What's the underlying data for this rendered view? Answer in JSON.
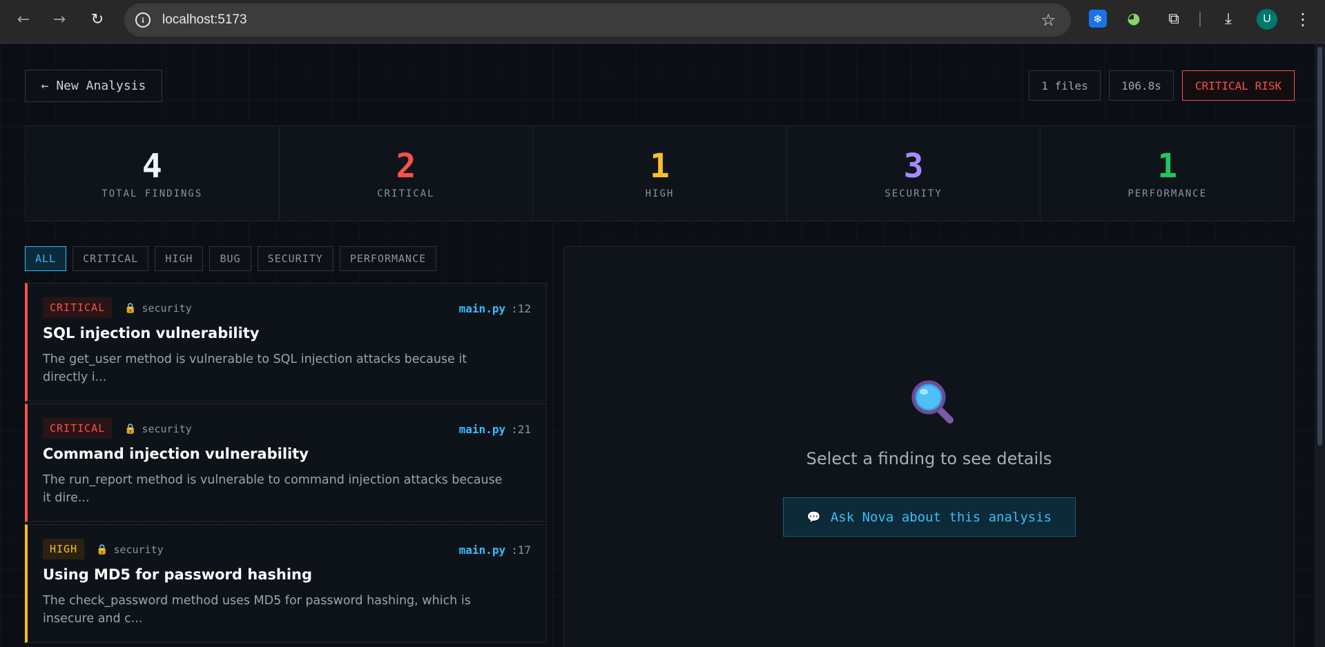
{
  "browser": {
    "url": "localhost:5173",
    "avatar_letter": "U",
    "icons": {
      "back": "back-arrow-icon",
      "forward": "forward-arrow-icon",
      "reload": "reload-icon",
      "info": "site-info-icon",
      "bookmark": "star-icon",
      "extension_1": "snowflake-extension-icon",
      "extension_2": "globe-extension-icon",
      "extensions": "puzzle-icon",
      "downloads": "download-icon",
      "menu": "kebab-menu-icon"
    }
  },
  "header": {
    "back_label": "← New Analysis",
    "files": "1 files",
    "duration": "106.8s",
    "risk": "CRITICAL RISK"
  },
  "stats": [
    {
      "value": "4",
      "label": "TOTAL FINDINGS",
      "color": "#f0f6fc"
    },
    {
      "value": "2",
      "label": "CRITICAL",
      "color": "#f85149"
    },
    {
      "value": "1",
      "label": "HIGH",
      "color": "#fbbf24"
    },
    {
      "value": "3",
      "label": "SECURITY",
      "color": "#a78bfa"
    },
    {
      "value": "1",
      "label": "PERFORMANCE",
      "color": "#22c55e"
    }
  ],
  "filters": [
    "ALL",
    "CRITICAL",
    "HIGH",
    "BUG",
    "SECURITY",
    "PERFORMANCE"
  ],
  "active_filter": "ALL",
  "findings": [
    {
      "severity": "CRITICAL",
      "category": "security",
      "file": "main.py",
      "line": ":12",
      "title": "SQL injection vulnerability",
      "description": "The get_user method is vulnerable to SQL injection attacks because it directly i..."
    },
    {
      "severity": "CRITICAL",
      "category": "security",
      "file": "main.py",
      "line": ":21",
      "title": "Command injection vulnerability",
      "description": "The run_report method is vulnerable to command injection attacks because it dire..."
    },
    {
      "severity": "HIGH",
      "category": "security",
      "file": "main.py",
      "line": ":17",
      "title": "Using MD5 for password hashing",
      "description": "The check_password method uses MD5 for password hashing, which is insecure and c..."
    }
  ],
  "detail": {
    "placeholder": "Select a finding to see details",
    "ask_label": "Ask Nova about this analysis",
    "icons": {
      "empty_state": "magnifier-icon",
      "ask": "speech-bubble-icon"
    }
  },
  "colors": {
    "accent": "#38bdf8",
    "critical": "#f85149",
    "high": "#fbbf24",
    "security": "#a78bfa",
    "performance": "#22c55e"
  }
}
